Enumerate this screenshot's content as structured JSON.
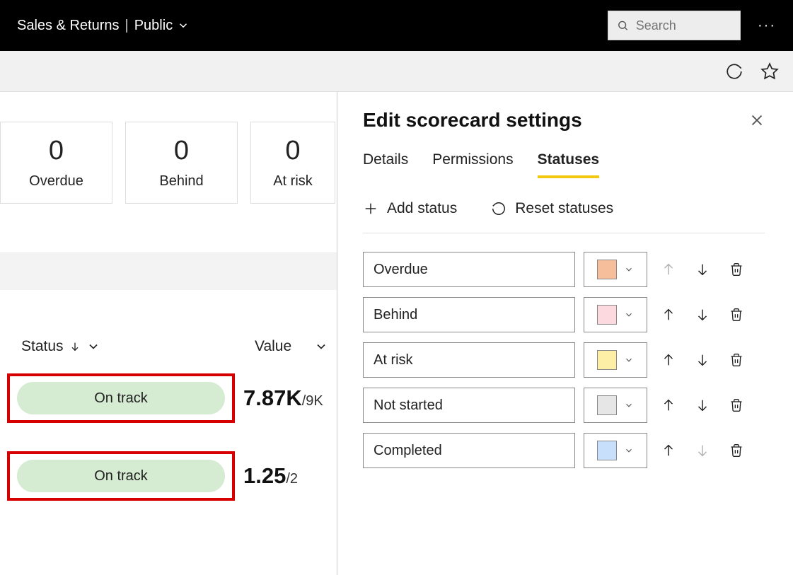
{
  "header": {
    "title": "Sales & Returns",
    "scope": "Public",
    "search_placeholder": "Search"
  },
  "kpis": [
    {
      "value": "0",
      "label": "Overdue"
    },
    {
      "value": "0",
      "label": "Behind"
    },
    {
      "value": "0",
      "label": "At risk"
    }
  ],
  "table": {
    "status_col": "Status",
    "value_col": "Value",
    "rows": [
      {
        "status": "On track",
        "value": "7.87K",
        "denom": "/9K"
      },
      {
        "status": "On track",
        "value": "1.25",
        "denom": "/2"
      }
    ]
  },
  "panel": {
    "title": "Edit scorecard settings",
    "tabs": {
      "details": "Details",
      "permissions": "Permissions",
      "statuses": "Statuses"
    },
    "add_status": "Add status",
    "reset_statuses": "Reset statuses",
    "statuses": [
      {
        "name": "Overdue",
        "color": "#f7be9c",
        "up_disabled": true,
        "down_disabled": false
      },
      {
        "name": "Behind",
        "color": "#fbd9de",
        "up_disabled": false,
        "down_disabled": false
      },
      {
        "name": "At risk",
        "color": "#fdf0a6",
        "up_disabled": false,
        "down_disabled": false
      },
      {
        "name": "Not started",
        "color": "#e6e6e6",
        "up_disabled": false,
        "down_disabled": false
      },
      {
        "name": "Completed",
        "color": "#c7dffb",
        "up_disabled": false,
        "down_disabled": true
      }
    ]
  }
}
